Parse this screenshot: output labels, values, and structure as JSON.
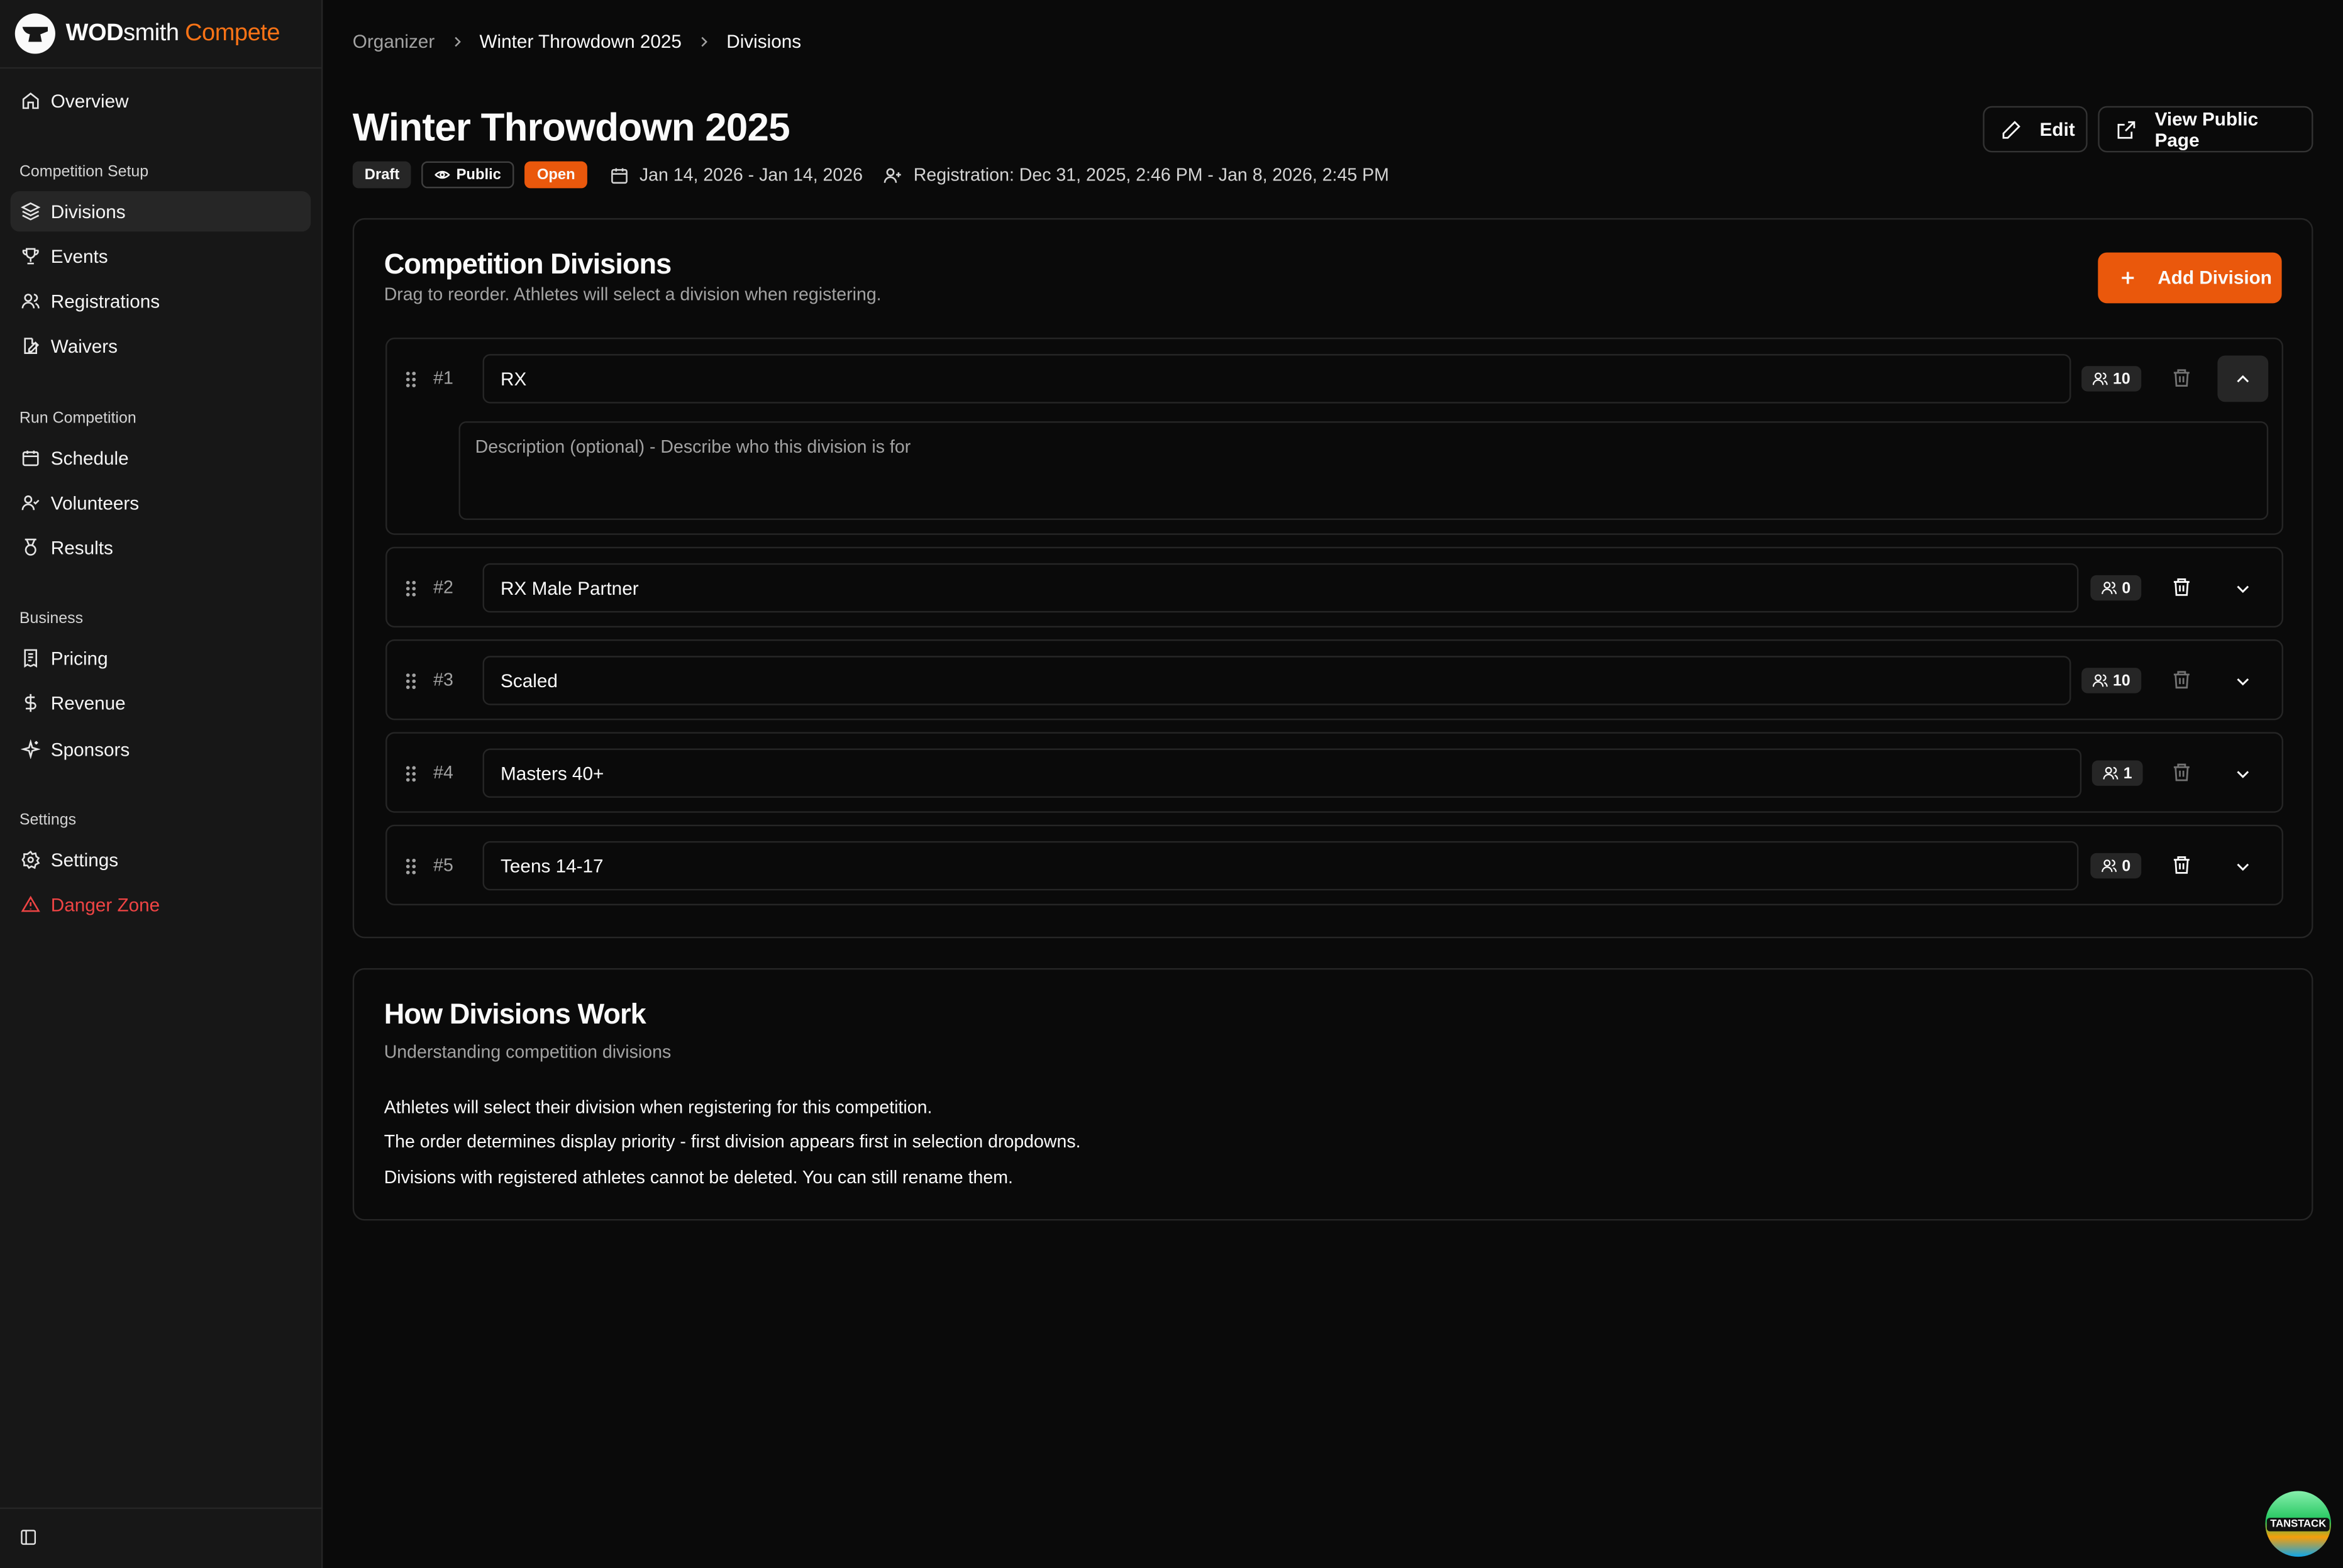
{
  "brand": {
    "part1": "WOD",
    "part2": "smith",
    "part3": "Compete"
  },
  "sidebar": {
    "overview": "Overview",
    "groups": {
      "setup": "Competition Setup",
      "run": "Run Competition",
      "business": "Business",
      "settings": "Settings"
    },
    "items": {
      "divisions": "Divisions",
      "events": "Events",
      "registrations": "Registrations",
      "waivers": "Waivers",
      "schedule": "Schedule",
      "volunteers": "Volunteers",
      "results": "Results",
      "pricing": "Pricing",
      "revenue": "Revenue",
      "sponsors": "Sponsors",
      "settings": "Settings",
      "danger": "Danger Zone"
    }
  },
  "breadcrumb": [
    "Organizer",
    "Winter Throwdown 2025",
    "Divisions"
  ],
  "header": {
    "title": "Winter Throwdown 2025",
    "badges": {
      "draft": "Draft",
      "public": "Public",
      "open": "Open"
    },
    "dates": "Jan 14, 2026 - Jan 14, 2026",
    "registration": "Registration: Dec 31, 2025, 2:46 PM - Jan 8, 2026, 2:45 PM",
    "edit_label": "Edit",
    "view_public_label": "View Public Page"
  },
  "divisions_card": {
    "title": "Competition Divisions",
    "subtitle": "Drag to reorder. Athletes will select a division when registering.",
    "add_label": "Add Division",
    "description_placeholder": "Description (optional) - Describe who this division is for",
    "rows": [
      {
        "num": "#1",
        "name": "RX",
        "count": "10",
        "expanded": true
      },
      {
        "num": "#2",
        "name": "RX Male Partner",
        "count": "0",
        "expanded": false
      },
      {
        "num": "#3",
        "name": "Scaled",
        "count": "10",
        "expanded": false
      },
      {
        "num": "#4",
        "name": "Masters 40+",
        "count": "1",
        "expanded": false
      },
      {
        "num": "#5",
        "name": "Teens 14-17",
        "count": "0",
        "expanded": false
      }
    ]
  },
  "info_card": {
    "title": "How Divisions Work",
    "subtitle": "Understanding competition divisions",
    "lines": [
      "Athletes will select their division when registering for this competition.",
      "The order determines display priority - first division appears first in selection dropdowns.",
      "Divisions with registered athletes cannot be deleted. You can still rename them."
    ]
  },
  "badge_logo": "TANSTACK",
  "colors": {
    "accent": "#ea580c",
    "danger": "#ef4444",
    "background": "#0a0a0a",
    "sidebar": "#171717"
  }
}
